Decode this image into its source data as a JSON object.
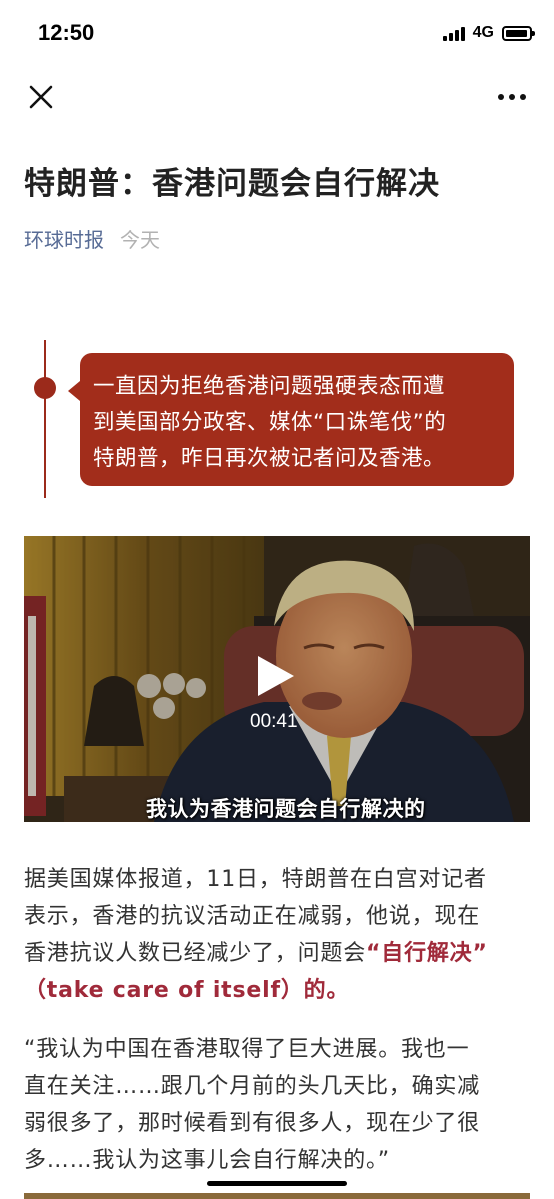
{
  "status_bar": {
    "time": "12:50",
    "network": "4G",
    "signal_bars": 4,
    "battery_level": 0.8
  },
  "nav": {
    "close_icon": "close-icon",
    "more_icon": "more-icon"
  },
  "article": {
    "title": "特朗普：香港问题会自行解决",
    "source": "环球时报",
    "date": "今天",
    "callout": {
      "line1": "一直因为拒绝香港问题强硬表态而遭",
      "line2": "到美国部分政客、媒体“口诛笔伐”的",
      "line3": "特朗普，昨日再次被记者问及香港。",
      "color": "#a22d1b"
    },
    "video": {
      "duration": "00:41",
      "subtitle": "我认为香港问题会自行解决的",
      "play_icon": "play-icon"
    },
    "paragraph1": {
      "line1": "据美国媒体报道，11日，特朗普在白宫对记者",
      "line2": "表示，香港的抗议活动正在减弱，他说，现在",
      "line3_prefix": "香港抗议人数已经减少了，问题会",
      "line3_highlight": "“自行解决”",
      "line4_highlight": "（take care of itself）",
      "line4_suffix": "的。",
      "highlight_color": "#a02a3a"
    },
    "paragraph2": {
      "line1": "“我认为中国在香港取得了巨大进展。我也一",
      "line2": "直在关注……跟几个月前的头几天比，确实减",
      "line3": "弱很多了，那时候看到有很多人，现在少了很",
      "line4": "多……我认为这事儿会自行解决的。”"
    }
  }
}
